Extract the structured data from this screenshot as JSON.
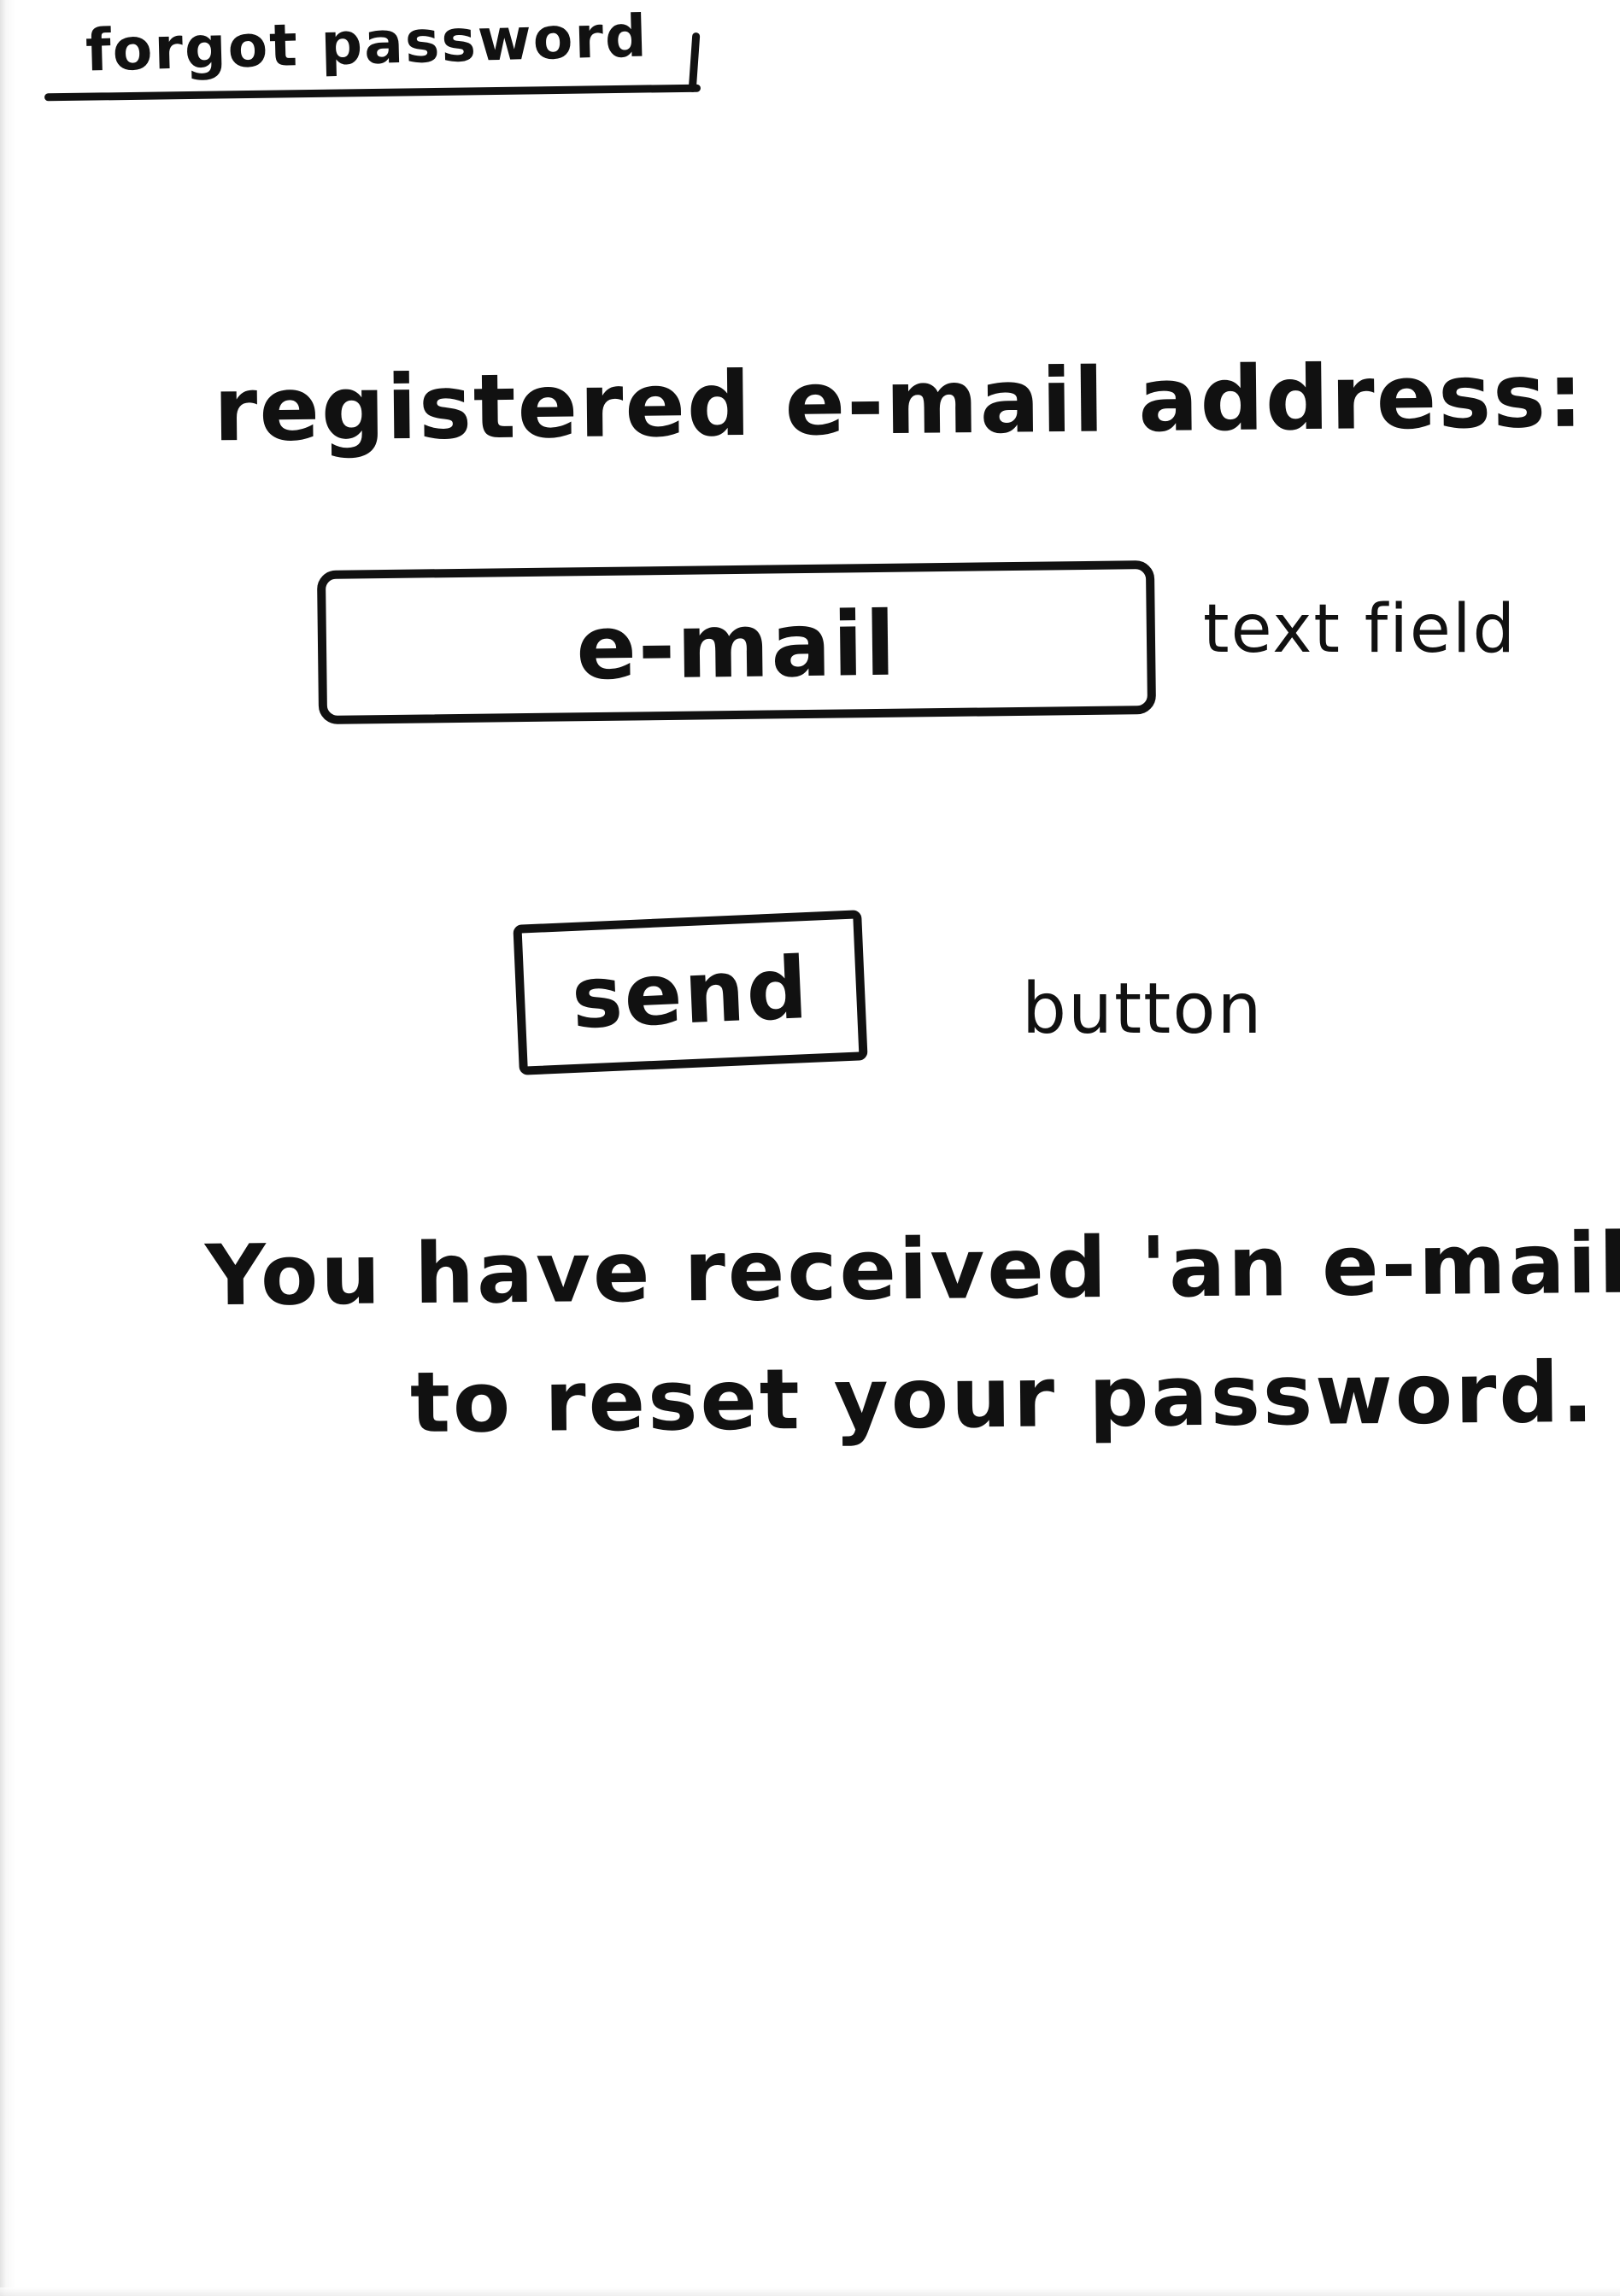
{
  "screen": {
    "title": "forgot password",
    "email_label": "registered e-mail address:",
    "email_field": {
      "placeholder": "e-mail",
      "annotation": "text field"
    },
    "send_button": {
      "label": "send",
      "annotation": "button"
    },
    "confirmation": {
      "line1": "You have received 'an e-mail",
      "line2": "to reset your password."
    }
  },
  "colors": {
    "ink": "#111111",
    "paper": "#ffffff"
  }
}
